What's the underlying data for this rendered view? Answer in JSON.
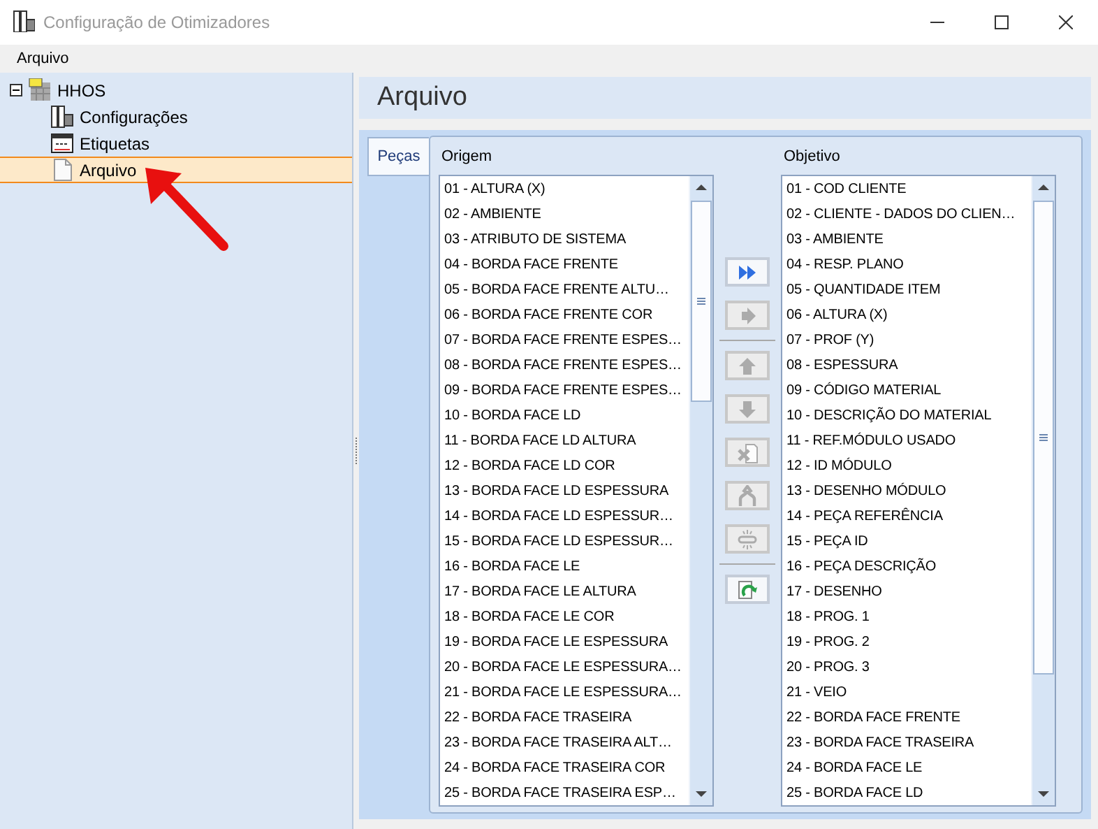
{
  "window": {
    "title": "Configuração de Otimizadores"
  },
  "menu": [
    {
      "label": "Arquivo"
    }
  ],
  "tree": [
    {
      "label": "HHOS",
      "expanded": true,
      "selected": false,
      "children": [
        {
          "label": "Configurações",
          "selected": false
        },
        {
          "label": "Etiquetas",
          "selected": false
        },
        {
          "label": "Arquivo",
          "selected": true
        }
      ]
    }
  ],
  "annotation": {
    "kind": "arrow"
  },
  "header": {
    "title": "Arquivo"
  },
  "tabs": [
    {
      "label": "Peças",
      "selected": true
    }
  ],
  "origem": {
    "label": "Origem",
    "items": [
      "01 - ALTURA (X)",
      "02 - AMBIENTE",
      "03 - ATRIBUTO DE SISTEMA",
      "04 - BORDA FACE FRENTE",
      "05 - BORDA FACE FRENTE ALTU…",
      "06 - BORDA FACE FRENTE COR",
      "07 - BORDA FACE FRENTE ESPES…",
      "08 - BORDA FACE FRENTE ESPES…",
      "09 - BORDA FACE FRENTE ESPES…",
      "10 - BORDA FACE LD",
      "11 - BORDA FACE LD ALTURA",
      "12 - BORDA FACE LD COR",
      "13 - BORDA FACE LD ESPESSURA",
      "14 - BORDA FACE LD ESPESSUR…",
      "15 - BORDA FACE LD ESPESSUR…",
      "16 - BORDA FACE LE",
      "17 - BORDA FACE LE ALTURA",
      "18 - BORDA FACE LE COR",
      "19 - BORDA FACE LE ESPESSURA",
      "20 - BORDA FACE LE ESPESSURA…",
      "21 - BORDA FACE LE ESPESSURA…",
      "22 - BORDA FACE TRASEIRA",
      "23 - BORDA FACE TRASEIRA ALT…",
      "24 - BORDA FACE TRASEIRA COR",
      "25 - BORDA FACE TRASEIRA ESP…"
    ]
  },
  "buttons": [
    {
      "kind": "add-all",
      "disabled": false
    },
    {
      "kind": "add",
      "disabled": true
    },
    {
      "kind": "up",
      "disabled": true
    },
    {
      "kind": "down",
      "disabled": true
    },
    {
      "kind": "delete",
      "disabled": true
    },
    {
      "kind": "merge",
      "disabled": true
    },
    {
      "kind": "unlink",
      "disabled": true
    },
    {
      "kind": "refresh",
      "disabled": false
    }
  ],
  "objetivo": {
    "label": "Objetivo",
    "items": [
      "01 - COD CLIENTE",
      "02 - CLIENTE - DADOS DO CLIEN…",
      "03 - AMBIENTE",
      "04 - RESP. PLANO",
      "05 - QUANTIDADE ITEM",
      "06 - ALTURA (X)",
      "07 - PROF (Y)",
      "08 - ESPESSURA",
      "09 - CÓDIGO MATERIAL",
      "10 - DESCRIÇÃO DO MATERIAL",
      "11 - REF.MÓDULO USADO",
      "12 - ID MÓDULO",
      "13 - DESENHO MÓDULO",
      "14 - PEÇA REFERÊNCIA",
      "15 - PEÇA ID",
      "16 - PEÇA DESCRIÇÃO",
      "17 - DESENHO",
      "18 - PROG. 1",
      "19 - PROG. 2",
      "20 - PROG. 3",
      "21 - VEIO",
      "22 - BORDA FACE FRENTE",
      "23 - BORDA FACE TRASEIRA",
      "24 - BORDA FACE LE",
      "25 - BORDA FACE LD"
    ]
  }
}
